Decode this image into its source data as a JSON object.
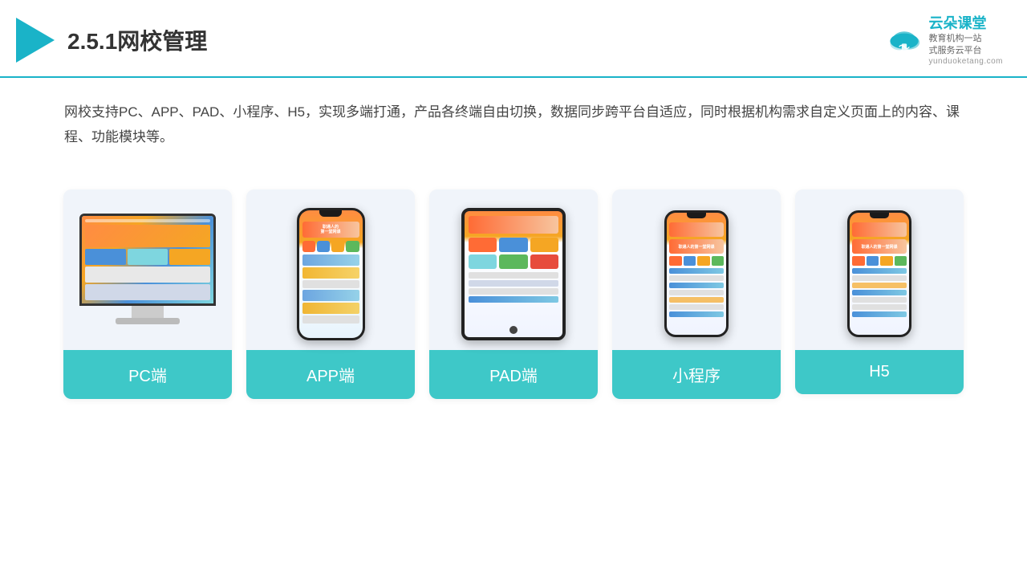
{
  "header": {
    "title": "2.5.1网校管理",
    "brand_name": "云朵课堂",
    "brand_tagline_line1": "教育机构一站",
    "brand_tagline_line2": "式服务云平台",
    "brand_url": "yunduoketang.com"
  },
  "description": {
    "text": "网校支持PC、APP、PAD、小程序、H5，实现多端打通，产品各终端自由切换，数据同步跨平台自适应，同时根据机构需求自定义页面上的内容、课程、功能模块等。"
  },
  "cards": [
    {
      "id": "pc",
      "label": "PC端"
    },
    {
      "id": "app",
      "label": "APP端"
    },
    {
      "id": "pad",
      "label": "PAD端"
    },
    {
      "id": "miniprogram",
      "label": "小程序"
    },
    {
      "id": "h5",
      "label": "H5"
    }
  ]
}
